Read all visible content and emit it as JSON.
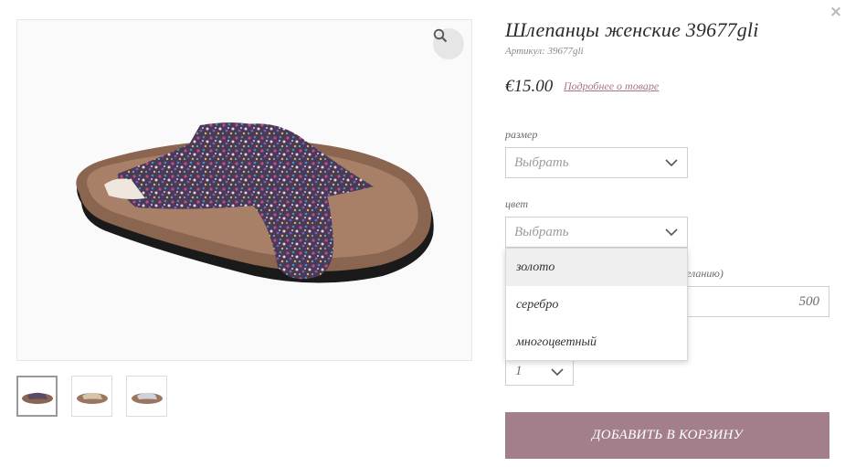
{
  "product": {
    "title": "Шлепанцы женские 39677gli",
    "sku": "Артикул: 39677gli",
    "price": "€15.00",
    "details_link": "Подробнее о товаре"
  },
  "size": {
    "label": "размер",
    "value": "Выбрать"
  },
  "color": {
    "label": "цвет",
    "value": "Выбрать",
    "options": [
      "золото",
      "серебро",
      "многоцветный"
    ]
  },
  "amount": {
    "label_partial": "желанию)",
    "value": "500"
  },
  "quantity": {
    "value": "1"
  },
  "add_to_cart": "ДОБАВИТЬ В КОРЗИНУ",
  "colors": {
    "button": "#a37f8c",
    "link": "#a37787"
  },
  "icons": {
    "close": "×",
    "zoom": "search-icon"
  }
}
